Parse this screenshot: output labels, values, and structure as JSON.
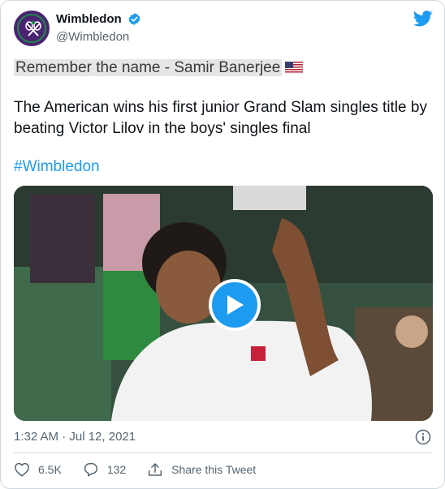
{
  "account": {
    "display_name": "Wimbledon",
    "handle": "@Wimbledon",
    "avatar_icon": "wimbledon-logo-icon",
    "verified_icon": "verified-badge-icon"
  },
  "tweet": {
    "line1": "Remember the name - Samir Banerjee",
    "body": "The American wins his first junior Grand Slam singles title by beating Victor Lilov in the boys' singles final",
    "hashtag": "#Wimbledon",
    "flag_icon": "us-flag-icon"
  },
  "media": {
    "play_icon": "play-icon"
  },
  "meta": {
    "timestamp": "1:32 AM · Jul 12, 2021"
  },
  "actions": {
    "likes": "6.5K",
    "replies": "132",
    "share_label": "Share this Tweet"
  },
  "colors": {
    "accent": "#1d9bf0",
    "secondary_text": "#536471",
    "brand_purple": "#4b2371",
    "brand_green": "#1c8a4a"
  }
}
